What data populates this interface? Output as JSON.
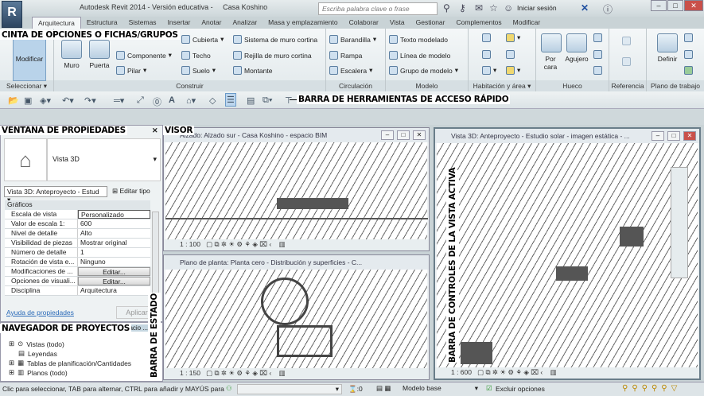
{
  "title": {
    "app": "Autodesk Revit 2014 - Versión educativa -",
    "project": "Casa Koshino",
    "app_button": "R"
  },
  "search": {
    "placeholder": "Escriba palabra clave o frase"
  },
  "login": "Iniciar sesión",
  "tabs": [
    "Arquitectura",
    "Estructura",
    "Sistemas",
    "Insertar",
    "Anotar",
    "Analizar",
    "Masa y emplazamiento",
    "Colaborar",
    "Vista",
    "Gestionar",
    "Complementos",
    "Modificar"
  ],
  "ribbon": {
    "modificar": "Modificar",
    "muro": "Muro",
    "puerta": "Puerta",
    "componente": "Componente",
    "pilar": "Pilar",
    "cubierta": "Cubierta",
    "techo": "Techo",
    "suelo": "Suelo",
    "sistema_muro": "Sistema de muro cortina",
    "rejilla": "Rejilla de muro cortina",
    "montante": "Montante",
    "barandilla": "Barandilla",
    "rampa": "Rampa",
    "escalera": "Escalera",
    "texto_modelado": "Texto modelado",
    "linea_modelo": "Línea de modelo",
    "grupo_modelo": "Grupo de modelo",
    "por_cara": "Por cara",
    "agujero": "Agujero",
    "definir": "Definir",
    "panels": {
      "seleccionar": "Seleccionar ▾",
      "construir": "Construir",
      "circulacion": "Circulación",
      "modelo": "Modelo",
      "habitacion": "Habitación y área ▾",
      "hueco": "Hueco",
      "referencia": "Referencia",
      "plano_trabajo": "Plano de trabajo"
    }
  },
  "annotations": {
    "ribbon": "CINTA DE OPCIONES O FICHAS/GRUPOS",
    "qat": "BARRA DE HERRAMIENTAS DE ACCESO RÁPIDO",
    "props": "VENTANA DE PROPIEDADES",
    "visor": "VISOR",
    "browser": "NAVEGADOR DE PROYECTOS",
    "status": "BARRA DE ESTADO",
    "view_controls": "BARRA DE CONTROLES DE LA VISTA ACTIVA"
  },
  "properties": {
    "type": "Vista 3D",
    "selector": "Vista 3D: Anteproyecto - Estud",
    "edit_type": "Editar tipo",
    "group": "Gráficos",
    "rows": [
      [
        "Escala de vista",
        "Personalizado"
      ],
      [
        "Valor de escala    1:",
        "600"
      ],
      [
        "Nivel de detalle",
        "Alto"
      ],
      [
        "Visibilidad de piezas",
        "Mostrar original"
      ],
      [
        "Número de detalle",
        "1"
      ],
      [
        "Rotación de vista e...",
        "Ninguno"
      ],
      [
        "Modificaciones de ...",
        "Editar..."
      ],
      [
        "Opciones de visuali...",
        "Editar..."
      ],
      [
        "Disciplina",
        "Arquitectura"
      ]
    ],
    "help": "Ayuda de propiedades",
    "apply": "Aplicar"
  },
  "browser": {
    "tab_fragment": "spacio ...",
    "items": [
      "Vistas (todo)",
      "Leyendas",
      "Tablas de planificación/Cantidades",
      "Planos (todo)"
    ]
  },
  "views": [
    {
      "title": "Alzado: Alzado sur - Casa Koshino - espacio BIM",
      "scale": "1 : 100"
    },
    {
      "title": "Plano de planta: Planta cero - Distribución y superficies - C...",
      "scale": "1 : 150"
    },
    {
      "title": "Vista 3D: Anteproyecto - Estudio solar - imagen estática - ...",
      "scale": "1 : 600"
    }
  ],
  "status": {
    "message": "Clic para seleccionar, TAB para alternar, CTRL para añadir y MAYÚS para",
    "count": ":0",
    "workset": "Modelo base",
    "exclude": "Excluir opciones"
  }
}
